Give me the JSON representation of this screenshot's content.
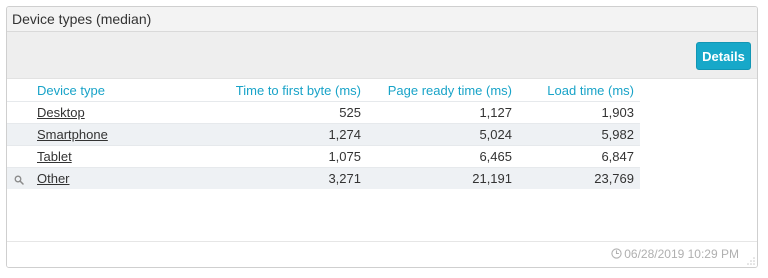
{
  "panel": {
    "title": "Device types (median)",
    "details_label": "Details",
    "timestamp": "06/28/2019 10:29 PM"
  },
  "table": {
    "headers": {
      "device_type": "Device type",
      "ttfb": "Time to first byte (ms)",
      "page_ready": "Page ready time (ms)",
      "load_time": "Load time (ms)"
    },
    "rows": [
      {
        "device_type": "Desktop",
        "ttfb": "525",
        "page_ready": "1,127",
        "load_time": "1,903"
      },
      {
        "device_type": "Smartphone",
        "ttfb": "1,274",
        "page_ready": "5,024",
        "load_time": "5,982"
      },
      {
        "device_type": "Tablet",
        "ttfb": "1,075",
        "page_ready": "6,465",
        "load_time": "6,847"
      },
      {
        "device_type": "Other",
        "ttfb": "3,271",
        "page_ready": "21,191",
        "load_time": "23,769"
      }
    ]
  },
  "icons": {
    "row_icon": "magnifier-icon",
    "timestamp_icon": "clock-icon",
    "corner": "resize-grip-icon"
  },
  "colors": {
    "accent": "#18a3c8",
    "button_bg": "#17a8c9",
    "header_bg": "#f3f3f3",
    "toolbar_bg": "#eeeeee",
    "row_alt_bg": "#eef1f4"
  }
}
